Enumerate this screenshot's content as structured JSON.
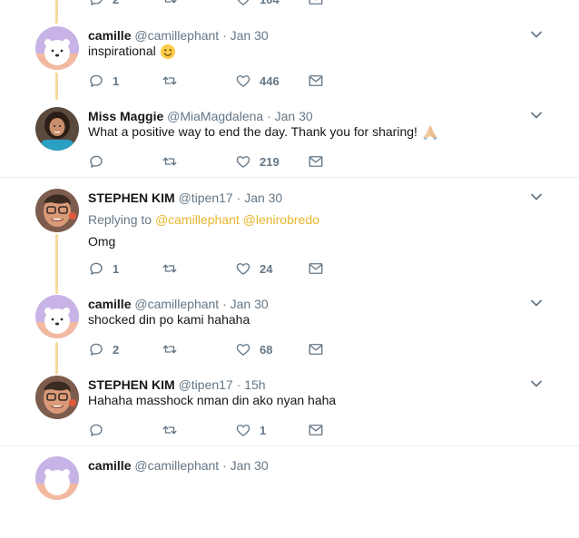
{
  "colors": {
    "accent": "#e8b52c",
    "thread_line": "#f5dba0",
    "muted": "#657786"
  },
  "top_partial": {
    "reply_count": "2",
    "like_count": "104"
  },
  "tweets": [
    {
      "name": "camille",
      "handle": "@camillephant",
      "dot": "·",
      "time": "Jan 30",
      "text": "inspirational",
      "reply_count": "1",
      "like_count": "446",
      "avatar": "bear-avatar"
    },
    {
      "name": "Miss Maggie",
      "handle": "@MiaMagdalena",
      "dot": "·",
      "time": "Jan 30",
      "text": "What a positive way to end the day. Thank you for sharing!",
      "reply_count": "",
      "like_count": "219",
      "avatar": "woman-avatar"
    },
    {
      "name": "STEPHEN KIM",
      "handle": "@tipen17",
      "dot": "·",
      "time": "Jan 30",
      "replying_label": "Replying to",
      "mention1": "@camillephant",
      "mention2": "@lenirobredo",
      "text": "Omg",
      "reply_count": "1",
      "like_count": "24",
      "avatar": "man-avatar"
    },
    {
      "name": "camille",
      "handle": "@camillephant",
      "dot": "·",
      "time": "Jan 30",
      "text": "shocked din po kami hahaha",
      "reply_count": "2",
      "like_count": "68",
      "avatar": "bear-avatar"
    },
    {
      "name": "STEPHEN KIM",
      "handle": "@tipen17",
      "dot": "·",
      "time": "15h",
      "text": "Hahaha masshock nman din ako nyan haha",
      "reply_count": "",
      "like_count": "1",
      "avatar": "man-avatar"
    },
    {
      "name": "camille",
      "handle": "@camillephant",
      "dot": "·",
      "time": "Jan 30",
      "avatar": "bear-avatar"
    }
  ]
}
